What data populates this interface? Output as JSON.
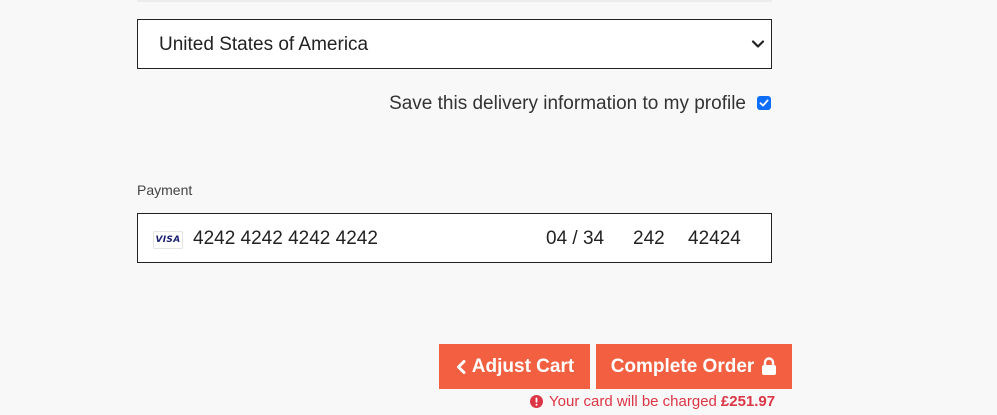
{
  "delivery": {
    "country_value": "United States of America",
    "save_label": "Save this delivery information to my profile",
    "save_checked": true
  },
  "payment": {
    "label": "Payment",
    "card_brand": "VISA",
    "card_number": "4242 4242 4242 4242",
    "expiry": "04 / 34",
    "cvc": "242",
    "zip": "42424"
  },
  "actions": {
    "adjust_label": "Adjust Cart",
    "complete_label": "Complete Order"
  },
  "charge_notice": {
    "text": "Your card will be charged",
    "amount": "£251.97"
  },
  "colors": {
    "accent": "#f25f41",
    "error": "#dc3545",
    "checkbox": "#0d6efd",
    "background": "#f8f8f8"
  },
  "icons": {
    "select": "chevron-down-icon",
    "adjust": "chevron-left-icon",
    "complete": "lock-icon",
    "notice": "exclamation-circle-icon"
  }
}
